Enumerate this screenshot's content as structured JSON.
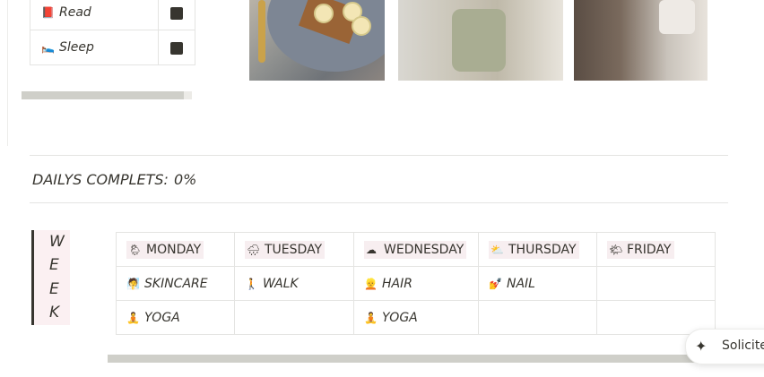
{
  "habits": [
    {
      "icon": "📕",
      "label": "Read"
    },
    {
      "icon": "🛌",
      "label": "Sleep"
    }
  ],
  "dailys": {
    "label": "DAILYS COMPLETS:",
    "value": "0%"
  },
  "week": {
    "letters": [
      "W",
      "E",
      "E",
      "K"
    ]
  },
  "days": [
    {
      "icon": "🌦",
      "label": "MONDAY"
    },
    {
      "icon": "🌧",
      "label": "TUESDAY"
    },
    {
      "icon": "☁",
      "label": "WEDNESDAY"
    },
    {
      "icon": "⛅",
      "label": "THURSDAY"
    },
    {
      "icon": "🌤",
      "label": "FRIDAY"
    }
  ],
  "rows": [
    [
      {
        "icon": "🧖",
        "text": "SKINCARE"
      },
      {
        "icon": "🚶",
        "text": "WALK"
      },
      {
        "icon": "👱",
        "text": "HAIR"
      },
      {
        "icon": "💅",
        "text": "NAIL"
      },
      {
        "icon": "",
        "text": ""
      }
    ],
    [
      {
        "icon": "🧘",
        "text": "YOGA"
      },
      {
        "icon": "",
        "text": ""
      },
      {
        "icon": "🧘",
        "text": "YOGA"
      },
      {
        "icon": "",
        "text": ""
      },
      {
        "icon": "",
        "text": ""
      }
    ]
  ],
  "ask_button": {
    "icon": "sparkle-icon",
    "label": "Solicite"
  }
}
